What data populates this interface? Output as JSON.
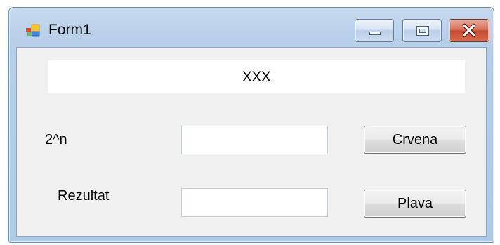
{
  "window": {
    "title": "Form1",
    "icon": "winforms-app-icon",
    "controls": {
      "minimize_icon": "minimize-icon",
      "maximize_icon": "maximize-icon",
      "close_icon": "close-icon",
      "close_color": "#c44b31"
    }
  },
  "form": {
    "display_text": "XXX",
    "power_label": "2^n",
    "power_value": "",
    "result_label": "Rezultat",
    "result_value": "",
    "red_button_label": "Crvena",
    "blue_button_label": "Plava"
  }
}
